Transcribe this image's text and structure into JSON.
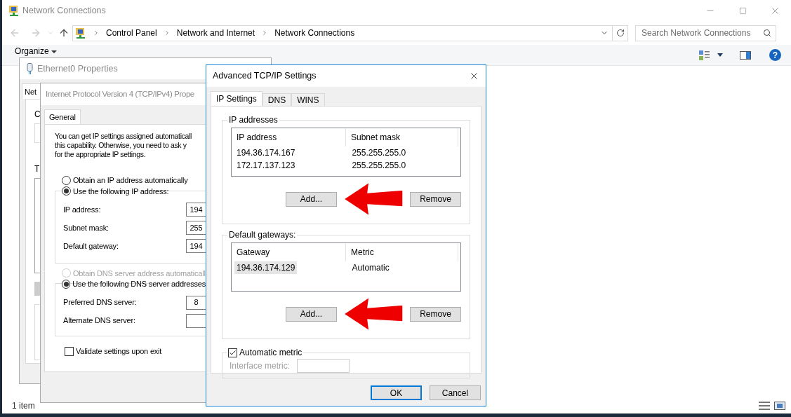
{
  "window": {
    "title": "Network Connections",
    "breadcrumb": [
      "Control Panel",
      "Network and Internet",
      "Network Connections"
    ],
    "search": {
      "placeholder": "Search Network Connections"
    },
    "organize": "Organize",
    "help_button": "?",
    "status_bar": "1 item"
  },
  "ethernet_dialog": {
    "title": "Ethernet0 Properties",
    "tab": "Net",
    "labels": [
      "C",
      "T"
    ]
  },
  "ipv4_dialog": {
    "title": "Internet Protocol Version 4 (TCP/IPv4) Prope",
    "tabs": [
      {
        "label": "General",
        "selected": true
      }
    ],
    "description_lines": [
      "You can get IP settings assigned automaticall",
      "this capability. Otherwise, you need to ask y",
      "for the appropriate IP settings."
    ],
    "ip_options": [
      {
        "label": "Obtain an IP address automatically",
        "selected": false,
        "disabled": false
      },
      {
        "label": "Use the following IP address:",
        "selected": true,
        "disabled": false
      }
    ],
    "ip_fields": [
      {
        "label": "IP address:",
        "value": "194"
      },
      {
        "label": "Subnet mask:",
        "value": "255"
      },
      {
        "label": "Default gateway:",
        "value": "194"
      }
    ],
    "dns_options": [
      {
        "label": "Obtain DNS server address automaticall",
        "selected": false,
        "disabled": true
      },
      {
        "label": "Use the following DNS server addresses",
        "selected": true,
        "disabled": false
      }
    ],
    "dns_fields": [
      {
        "label": "Preferred DNS server:",
        "value": "8"
      },
      {
        "label": "Alternate DNS server:"
      }
    ],
    "validate": {
      "label": "Validate settings upon exit",
      "checked": false
    }
  },
  "advanced_dialog": {
    "title": "Advanced TCP/IP Settings",
    "tabs": [
      {
        "label": "IP Settings",
        "selected": true
      },
      {
        "label": "DNS",
        "selected": false
      },
      {
        "label": "WINS",
        "selected": false
      }
    ],
    "groups": [
      {
        "title": "IP addresses",
        "columns": [
          "IP address",
          "Subnet mask"
        ],
        "rows": [
          {
            "cells": [
              "194.36.174.167",
              "255.255.255.0"
            ],
            "selected": false
          },
          {
            "cells": [
              "172.17.137.123",
              "255.255.255.0"
            ],
            "selected": false
          }
        ],
        "buttons": [
          "Add...",
          "Remove"
        ]
      },
      {
        "title": "Default gateways:",
        "columns": [
          "Gateway",
          "Metric"
        ],
        "rows": [
          {
            "cells": [
              "194.36.174.129",
              "Automatic"
            ],
            "selected": true
          }
        ],
        "buttons": [
          "Add...",
          "Remove"
        ]
      }
    ],
    "metric": {
      "label": "Automatic metric",
      "checked": true,
      "field_label": "Interface metric:",
      "disabled": true
    },
    "buttons": [
      {
        "label": "OK",
        "default": true
      },
      {
        "label": "Cancel",
        "default": false
      }
    ]
  }
}
